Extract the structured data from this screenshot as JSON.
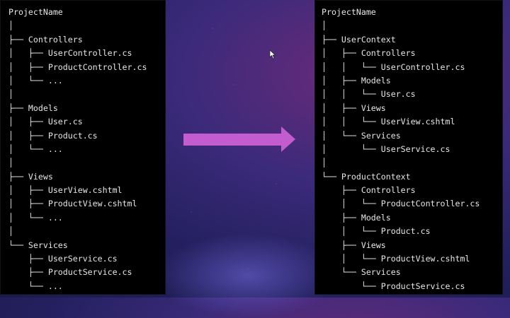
{
  "left_tree": [
    "ProjectName",
    "│",
    "├── Controllers",
    "│   ├── UserController.cs",
    "│   ├── ProductController.cs",
    "│   └── ...",
    "│",
    "├── Models",
    "│   ├── User.cs",
    "│   ├── Product.cs",
    "│   └── ...",
    "│",
    "├── Views",
    "│   ├── UserView.cshtml",
    "│   ├── ProductView.cshtml",
    "│   └── ...",
    "│",
    "└── Services",
    "    ├── UserService.cs",
    "    ├── ProductService.cs",
    "    └── ..."
  ],
  "right_tree": [
    "ProjectName",
    "│",
    "├── UserContext",
    "│   ├── Controllers",
    "│   │   └── UserController.cs",
    "│   ├── Models",
    "│   │   └── User.cs",
    "│   ├── Views",
    "│   │   └── UserView.cshtml",
    "│   └── Services",
    "│       └── UserService.cs",
    "│",
    "└── ProductContext",
    "    ├── Controllers",
    "    │   └── ProductController.cs",
    "    ├── Models",
    "    │   └── Product.cs",
    "    ├── Views",
    "    │   └── ProductView.cshtml",
    "    └── Services",
    "        └── ProductService.cs"
  ],
  "colors": {
    "arrow": "#c25ccf",
    "panel_background": "#000000",
    "text": "#e6e6e6"
  },
  "icons": {
    "arrow": "right-arrow-icon",
    "cursor": "mouse-cursor-icon"
  }
}
